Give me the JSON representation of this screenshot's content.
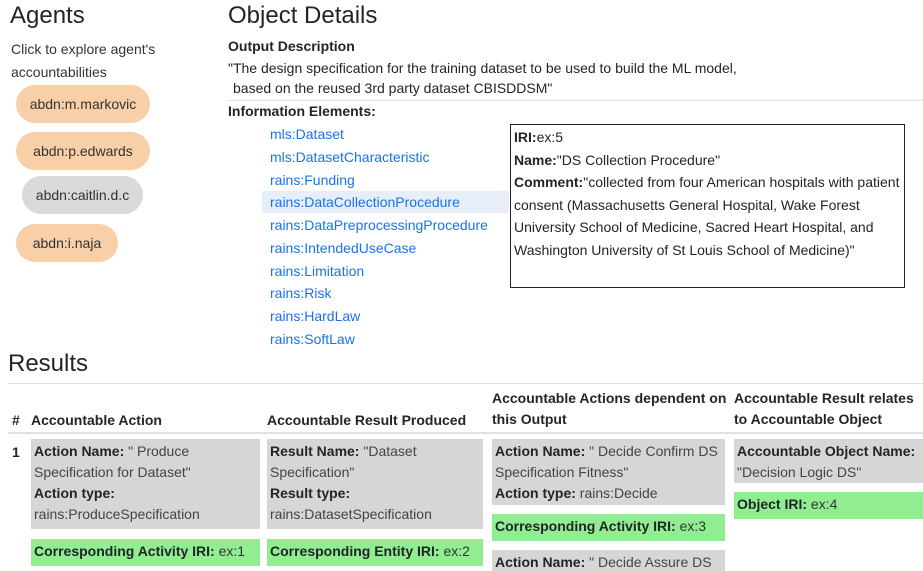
{
  "agents": {
    "title": "Agents",
    "hint": "Click to explore agent's accountabilities",
    "items": [
      {
        "label": "abdn:m.markovic",
        "color": "#f8cfa6"
      },
      {
        "label": "abdn:p.edwards",
        "color": "#f8cfa6"
      },
      {
        "label": "abdn:caitlin.d.c",
        "color": "#d9d9d9"
      },
      {
        "label": "abdn:i.naja",
        "color": "#f8cfa6"
      }
    ]
  },
  "object_details": {
    "title": "Object Details",
    "output_description_label": "Output Description",
    "output_description_line1": "\"The design specification for the training dataset to be used to build the ML model,",
    "output_description_line2": "based on the reused 3rd party dataset CBISDDSM\"",
    "information_elements_label": "Information Elements:",
    "information_elements": [
      "mls:Dataset",
      "mls:DatasetCharacteristic",
      "rains:Funding",
      "rains:DataCollectionProcedure",
      "rains:DataPreprocessingProcedure",
      "rains:IntendedUseCase",
      "rains:Limitation",
      "rains:Risk",
      "rains:HardLaw",
      "rains:SoftLaw"
    ],
    "selected_element": "rains:DataCollectionProcedure",
    "detail": {
      "iri_label": "IRI:",
      "iri_value": "ex:5",
      "name_label": "Name:",
      "name_value": "\"DS Collection Procedure\"",
      "comment_label": "Comment:",
      "comment_value": "\"collected from four American hospitals with patient consent (Massachusetts General Hospital, Wake Forest University School of Medicine, Sacred Heart Hospital, and Washington University of St Louis School of Medicine)\""
    }
  },
  "results": {
    "title": "Results",
    "columns": {
      "num": "#",
      "action": "Accountable Action",
      "result": "Accountable Result Produced",
      "dependent": "Accountable Actions dependent on this Output",
      "relates": "Accountable Result relates to Accountable Object"
    },
    "rows": [
      {
        "num": "1",
        "action": {
          "name_label": "Action Name:",
          "name_value": "\" Produce Specification for Dataset\"",
          "type_label": "Action type:",
          "type_value": "rains:ProduceSpecification",
          "activity_iri_label": "Corresponding Activity IRI:",
          "activity_iri_value": "ex:1"
        },
        "result": {
          "name_label": "Result Name:",
          "name_value": "\"Dataset Specification\"",
          "type_label": "Result type:",
          "type_value": "rains:DatasetSpecification",
          "entity_iri_label": "Corresponding Entity IRI:",
          "entity_iri_value": "ex:2"
        },
        "dependent": [
          {
            "name_label": "Action Name:",
            "name_value": "\" Decide Confirm DS Specification Fitness\"",
            "type_label": "Action type:",
            "type_value": "rains:Decide",
            "activity_iri_label": "Corresponding Activity IRI:",
            "activity_iri_value": "ex:3"
          },
          {
            "name_label": "Action Name:",
            "name_value": "\" Decide Assure DS"
          }
        ],
        "relates": {
          "object_label": "Accountable Object Name:",
          "object_value": "\"Decision Logic DS\"",
          "object_iri_label": "Object IRI:",
          "object_iri_value": "ex:4"
        }
      }
    ]
  },
  "colors": {
    "agent_orange": "#f8cfa6",
    "agent_gray": "#d9d9d9",
    "link_blue": "#1a73e8",
    "card_gray": "#d6d6d6",
    "card_green": "#90ee90"
  }
}
